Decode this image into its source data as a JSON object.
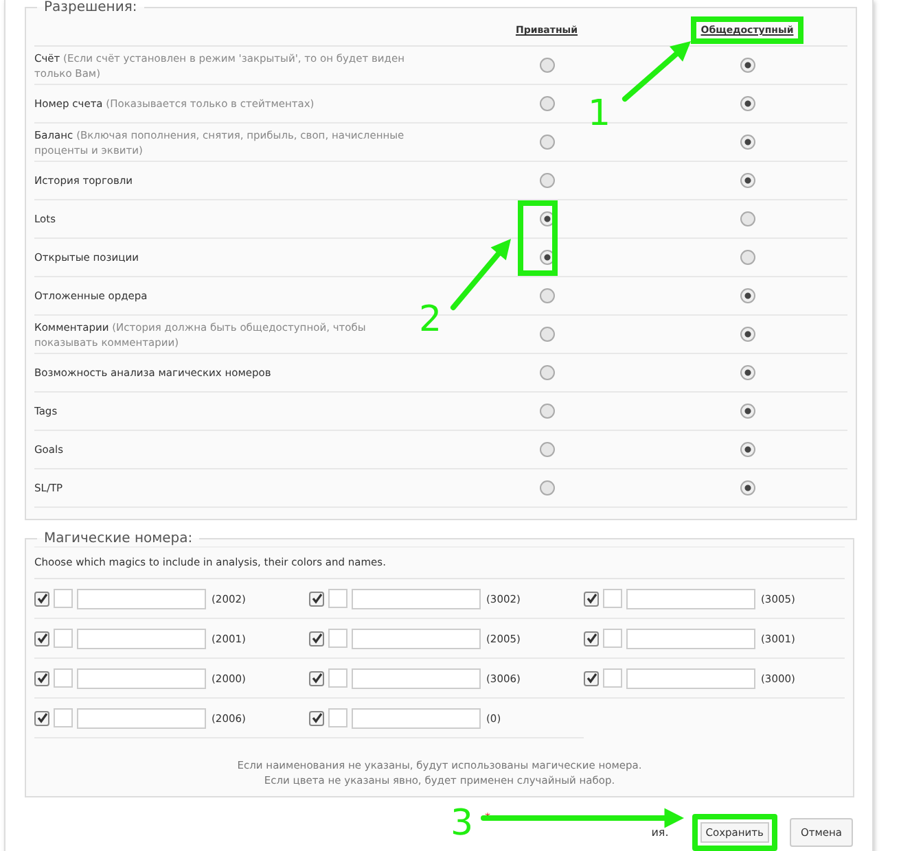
{
  "permissions": {
    "legend": "Разрешения:",
    "columns": [
      {
        "label": "Приватный",
        "highlighted": false
      },
      {
        "label": "Общедоступный",
        "highlighted": true
      }
    ],
    "rows": [
      {
        "label": "Счёт",
        "hint": "(Если счёт установлен в режим 'закрытый', то он будет виден только Вам)",
        "options": [
          {
            "selected": false
          },
          {
            "selected": true
          }
        ]
      },
      {
        "label": "Номер счета",
        "hint": "(Показывается только в стейтментах)",
        "options": [
          {
            "selected": false
          },
          {
            "selected": true
          }
        ]
      },
      {
        "label": "Баланс",
        "hint": "(Включая пополнения, снятия, прибыль, своп, начисленные проценты и эквити)",
        "options": [
          {
            "selected": false
          },
          {
            "selected": true
          }
        ]
      },
      {
        "label": "История торговли",
        "options": [
          {
            "selected": false
          },
          {
            "selected": true
          }
        ]
      },
      {
        "label": "Lots",
        "options": [
          {
            "selected": true
          },
          {
            "selected": false
          }
        ]
      },
      {
        "label": "Открытые позиции",
        "options": [
          {
            "selected": true
          },
          {
            "selected": false
          }
        ]
      },
      {
        "label": "Отложенные ордера",
        "options": [
          {
            "selected": false
          },
          {
            "selected": true
          }
        ]
      },
      {
        "label": "Комментарии",
        "hint": "(История должна быть общедоступной, чтобы показывать комментарии)",
        "options": [
          {
            "selected": false
          },
          {
            "selected": true
          }
        ]
      },
      {
        "label": "Возможность анализа магических номеров",
        "options": [
          {
            "selected": false
          },
          {
            "selected": true
          }
        ]
      },
      {
        "label": "Tags",
        "options": [
          {
            "selected": false
          },
          {
            "selected": true
          }
        ]
      },
      {
        "label": "Goals",
        "options": [
          {
            "selected": false
          },
          {
            "selected": true
          }
        ]
      },
      {
        "label": "SL/TP",
        "options": [
          {
            "selected": false
          },
          {
            "selected": true
          }
        ]
      }
    ]
  },
  "magics": {
    "legend": "Магические номера:",
    "description": "Choose which magics to include in analysis, their colors and names.",
    "items": [
      {
        "checked": true,
        "label": "(2002)"
      },
      {
        "checked": true,
        "label": "(3002)"
      },
      {
        "checked": true,
        "label": "(3005)"
      },
      {
        "checked": true,
        "label": "(2001)"
      },
      {
        "checked": true,
        "label": "(2005)"
      },
      {
        "checked": true,
        "label": "(3001)"
      },
      {
        "checked": true,
        "label": "(2000)"
      },
      {
        "checked": true,
        "label": "(3006)"
      },
      {
        "checked": true,
        "label": "(3000)"
      },
      {
        "checked": true,
        "label": "(2006)"
      },
      {
        "checked": true,
        "label": "(0)"
      }
    ],
    "notes": [
      "Если наименования не указаны, будут использованы магические номера.",
      "Если цвета не указаны явно, будет применен случайный набор."
    ]
  },
  "footer": {
    "asterisk": "*",
    "note_tail": "ия.",
    "buttons": [
      {
        "label": "Сохранить",
        "highlighted": true
      },
      {
        "label": "Отмена",
        "highlighted": false
      }
    ]
  },
  "annotations": [
    {
      "label": "1"
    },
    {
      "label": "2"
    },
    {
      "label": "3"
    }
  ]
}
